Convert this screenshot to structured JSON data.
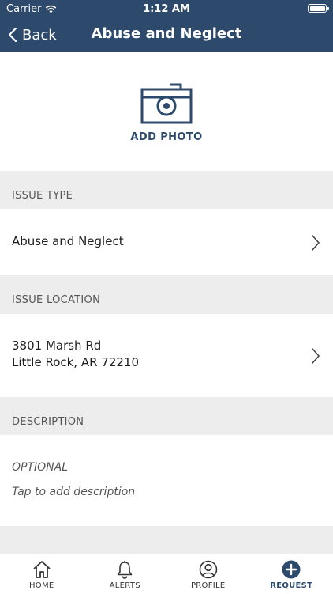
{
  "status_bar": {
    "carrier": "Carrier",
    "time": "1:12 AM"
  },
  "nav": {
    "back_label": "Back",
    "title": "Abuse and Neglect"
  },
  "photo": {
    "label": "ADD PHOTO",
    "icon": "camera-icon"
  },
  "issue_type": {
    "header": "ISSUE TYPE",
    "value": "Abuse and Neglect"
  },
  "issue_location": {
    "header": "ISSUE LOCATION",
    "line1": "3801 Marsh Rd",
    "line2": "Little Rock, AR 72210"
  },
  "description": {
    "header": "DESCRIPTION",
    "optional": "OPTIONAL",
    "placeholder": "Tap to add description"
  },
  "tabs": [
    {
      "label": "HOME",
      "icon": "home-icon"
    },
    {
      "label": "ALERTS",
      "icon": "bell-icon"
    },
    {
      "label": "PROFILE",
      "icon": "profile-icon"
    },
    {
      "label": "REQUEST",
      "icon": "plus-circle-icon"
    }
  ],
  "colors": {
    "brand": "#2d4a6d",
    "background": "#ededed"
  }
}
